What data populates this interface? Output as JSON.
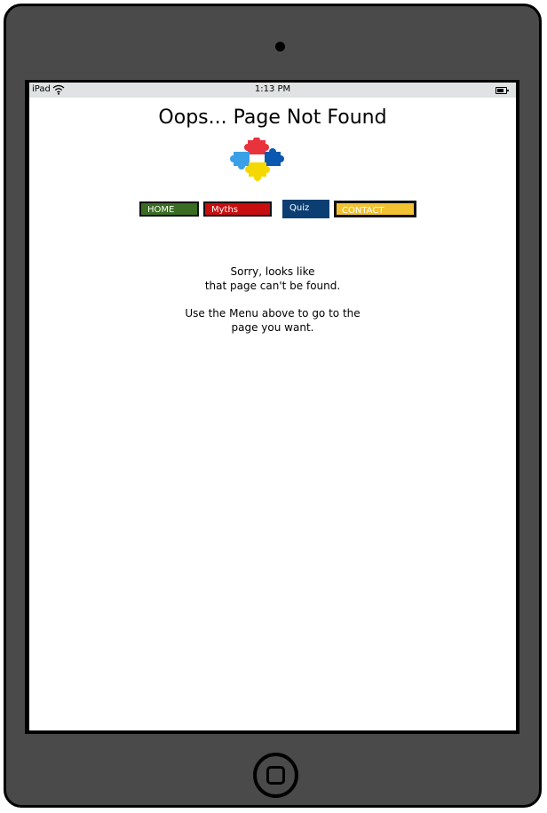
{
  "statusbar": {
    "carrier": "iPad",
    "time": "1:13 PM"
  },
  "page": {
    "title": "Oops... Page Not Found"
  },
  "nav": {
    "items": [
      {
        "label": "HOME",
        "color": "#3a6d22"
      },
      {
        "label": "Myths",
        "color": "#c80e0e"
      },
      {
        "label": "Quiz",
        "color": "#0b3f73"
      },
      {
        "label": "CONTACT",
        "color": "#f2c232"
      }
    ]
  },
  "message": {
    "line1": "Sorry, looks like",
    "line2": "that page can't be found.",
    "line3": "Use the Menu above to go to the",
    "line4": "page you want."
  },
  "logo": {
    "icon": "puzzle-logo-icon",
    "colors": [
      "#e8323c",
      "#3aa0e8",
      "#0a58b0",
      "#f5d800"
    ]
  },
  "device": {
    "body_color": "#4a4a4a",
    "statusbar_color": "#dfe3e4"
  }
}
